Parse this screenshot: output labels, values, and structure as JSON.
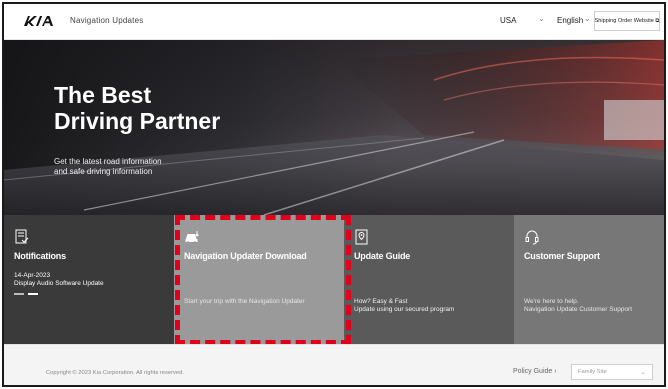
{
  "header": {
    "brand_sub": "Navigation Updates",
    "country": "USA",
    "language": "English",
    "ship_button": "Shipping Order Website ⧉",
    "chevron": "⌄"
  },
  "hero": {
    "title_line1": "The Best",
    "title_line2": "Driving Partner",
    "sub_line1": "Get the latest road information",
    "sub_line2": "and safe driving information"
  },
  "tiles": [
    {
      "title": "Notifications",
      "date": "14-Apr-2023",
      "notification": "Display Audio Software Update",
      "icon": "notification-checklist-icon"
    },
    {
      "title": "Navigation Updater Download",
      "desc": "Start your trip with the Navigation Updater",
      "icon": "car-download-icon"
    },
    {
      "title": "Update Guide",
      "desc_line1": "How? Easy & Fast",
      "desc_line2": "Update using our secured program",
      "icon": "map-pin-guide-icon"
    },
    {
      "title": "Customer Support",
      "desc_line1": "We're here to help.",
      "desc_line2": "Navigation Update Customer Support",
      "icon": "headset-icon"
    }
  ],
  "footer": {
    "copyright": "Copyright © 2023 Kia Corporation. All rights reserved.",
    "policy": "Policy Guide ›",
    "family_site": "Family Site",
    "chevron": "⌄"
  },
  "colors": {
    "highlight": "#e0001b",
    "tile_notifications": "#3a3a3a",
    "tile_download": "#9a9a9a",
    "tile_guide": "#5a5a5a",
    "tile_support": "#777777"
  }
}
